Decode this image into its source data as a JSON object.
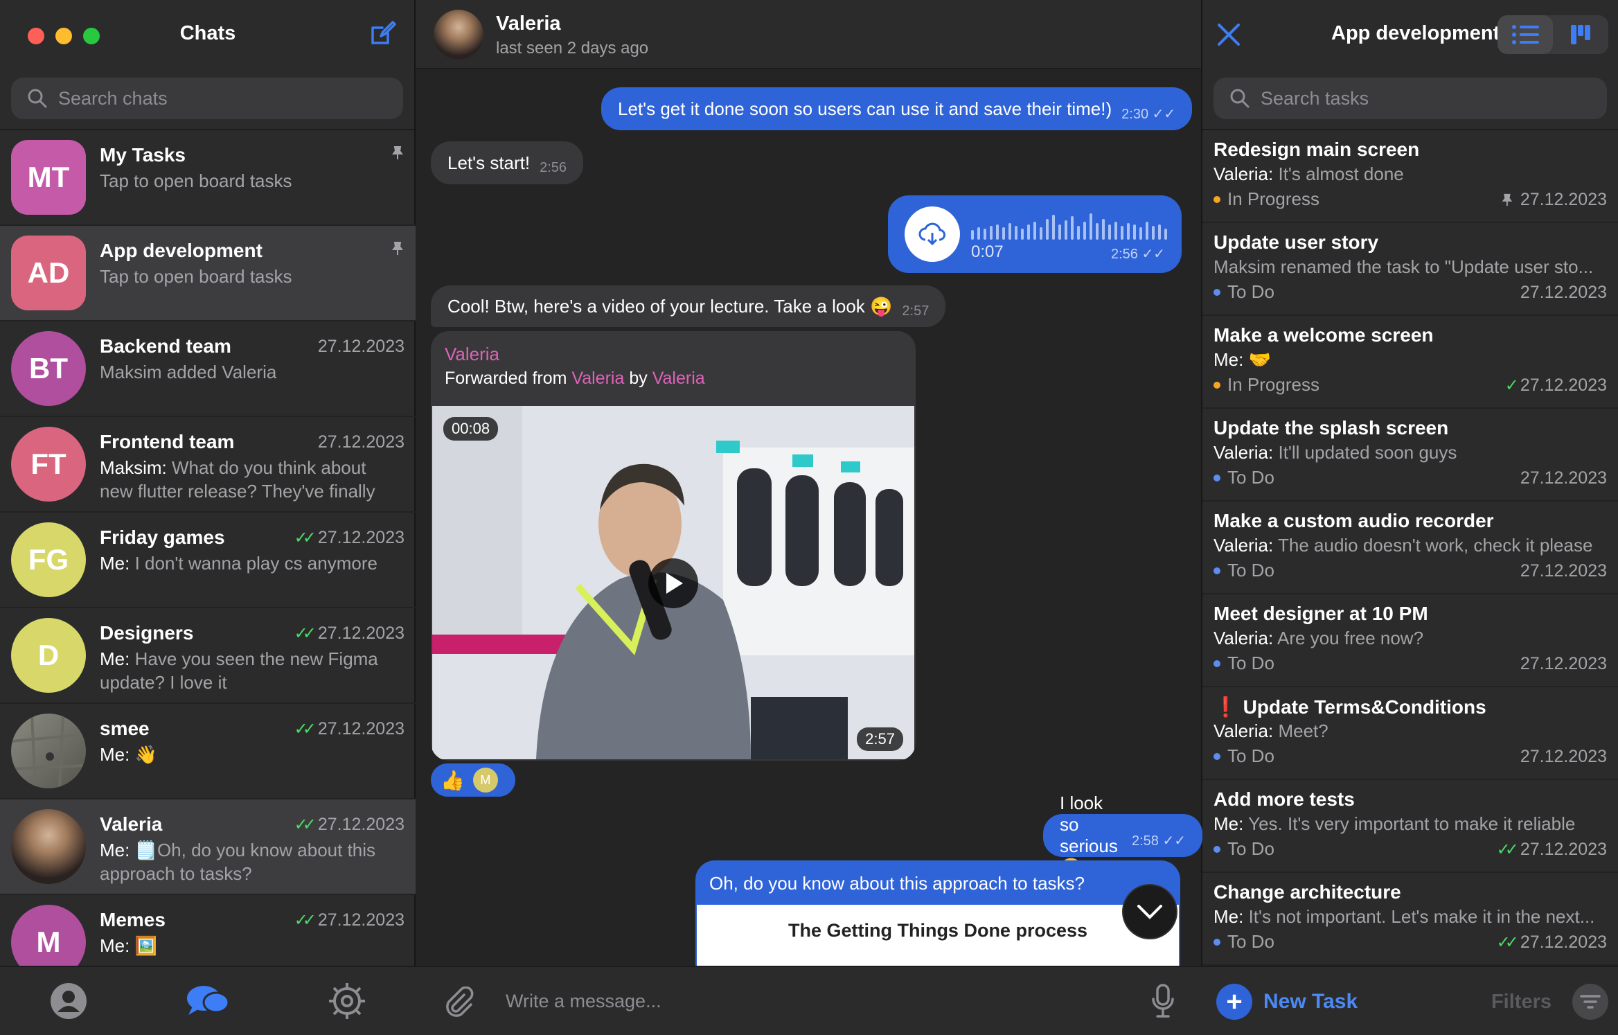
{
  "left": {
    "title": "Chats",
    "search_placeholder": "Search chats",
    "chats": [
      {
        "initials": "MT",
        "name": "My Tasks",
        "preview": "Tap to open board tasks",
        "date": "",
        "color": "#c55aa8"
      },
      {
        "initials": "AD",
        "name": "App development",
        "preview": "Tap to open board tasks",
        "date": "",
        "color": "#d9667e"
      },
      {
        "initials": "BT",
        "name": "Backend team",
        "preview": "Maksim added Valeria",
        "date": "27.12.2023",
        "color": "#b04f9e"
      },
      {
        "initials": "FT",
        "name": "Frontend team",
        "sender": "Maksim:",
        "preview": "What do you think about new flutter release? They've finally ...",
        "date": "27.12.2023",
        "color": "#d9667e"
      },
      {
        "initials": "FG",
        "name": "Friday games",
        "sender": "Me:",
        "preview": "I don't wanna play cs anymore",
        "date": "27.12.2023",
        "color": "#d8d86a"
      },
      {
        "initials": "D",
        "name": "Designers",
        "sender": "Me:",
        "preview": "Have you seen the new Figma update?   I love it",
        "date": "27.12.2023",
        "color": "#d8d86a"
      },
      {
        "initials": "",
        "name": "smee",
        "sender": "Me:",
        "preview": "👋",
        "date": "27.12.2023",
        "color": "#7a7a70"
      },
      {
        "initials": "",
        "name": "Valeria",
        "sender": "Me:",
        "preview": "🗒️Oh, do you know about this approach to tasks?",
        "date": "27.12.2023",
        "color": "#5a4a3a"
      },
      {
        "initials": "M",
        "name": "Memes",
        "sender": "Me:",
        "preview": "🖼️",
        "date": "27.12.2023",
        "color": "#b04f9e"
      }
    ]
  },
  "chat": {
    "name": "Valeria",
    "status": "last seen 2 days ago",
    "messages": [
      {
        "text": "Let's get it done soon so users can use it and save their time!)",
        "time": "2:30"
      },
      {
        "text": "Let's start!",
        "time": "2:56"
      },
      {
        "voice_duration": "0:07",
        "time": "2:56"
      },
      {
        "text": "Cool! Btw, here's a video of your lecture. Take a look 😜",
        "time": "2:57"
      },
      {
        "text": "I look so serious 🤨",
        "time": "2:58"
      }
    ],
    "forward": {
      "author": "Valeria",
      "line_prefix": "Forwarded from",
      "from": "Valeria",
      "by_word": "by",
      "by": "Valeria",
      "video_duration": "00:08",
      "time": "2:57"
    },
    "reaction": {
      "emoji": "👍",
      "user_initial": "M"
    },
    "gtd": {
      "text": "Oh, do you know about this approach to tasks?",
      "card_title": "The Getting Things Done process"
    },
    "input_placeholder": "Write a message..."
  },
  "right": {
    "title": "App development",
    "search_placeholder": "Search tasks",
    "tasks": [
      {
        "title": "Redesign main screen",
        "sender": "Valeria:",
        "preview": "It's almost done",
        "status": "In Progress",
        "date": "27.12.2023",
        "prio": ""
      },
      {
        "title": "Update user story",
        "sender": "",
        "preview": "Maksim renamed the task to \"Update user sto...",
        "status": "To Do",
        "date": "27.12.2023",
        "prio": ""
      },
      {
        "title": "Make a welcome screen",
        "sender": "Me:",
        "preview": "🤝",
        "status": "In Progress",
        "date": "27.12.2023",
        "prio": ""
      },
      {
        "title": "Update the splash screen",
        "sender": "Valeria:",
        "preview": "It'll updated soon guys",
        "status": "To Do",
        "date": "27.12.2023",
        "prio": ""
      },
      {
        "title": "Make a custom audio recorder",
        "sender": "Valeria:",
        "preview": "The audio doesn't work, check it please",
        "status": "To Do",
        "date": "27.12.2023",
        "prio": ""
      },
      {
        "title": "Meet designer at 10 PM",
        "sender": "Valeria:",
        "preview": "Are you free now?",
        "status": "To Do",
        "date": "27.12.2023",
        "prio": ""
      },
      {
        "title": "Update Terms&Conditions",
        "sender": "Valeria:",
        "preview": "Meet?",
        "status": "To Do",
        "date": "27.12.2023",
        "prio": "❗"
      },
      {
        "title": "Add more tests",
        "sender": "Me:",
        "preview": "Yes. It's very important to make it reliable",
        "status": "To Do",
        "date": "27.12.2023",
        "prio": ""
      },
      {
        "title": "Change architecture",
        "sender": "Me:",
        "preview": "It's not important. Let's make it in the next...",
        "status": "To Do",
        "date": "27.12.2023",
        "prio": ""
      }
    ],
    "new_task": "New Task",
    "filters": "Filters"
  }
}
